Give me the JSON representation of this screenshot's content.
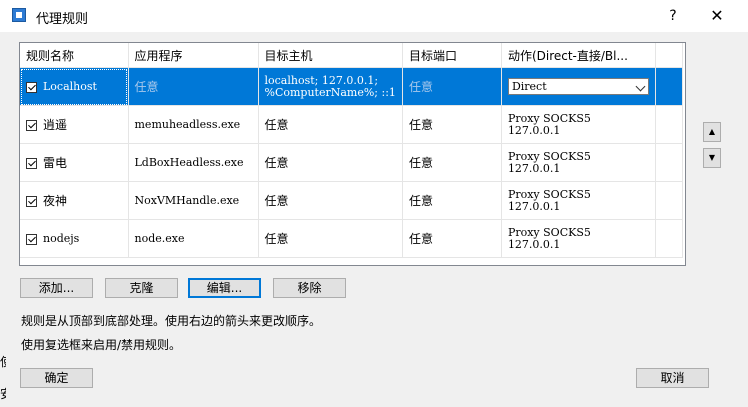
{
  "dialog": {
    "title": "代理规则",
    "help_label": "?",
    "close_label": "✕"
  },
  "table": {
    "columns": [
      "规则名称",
      "应用程序",
      "目标主机",
      "目标端口",
      "动作(Direct-直接/Bl..."
    ],
    "rows": [
      {
        "name": "Localhost",
        "app": "任意",
        "host_line1": "localhost; 127.0.0.1;",
        "host_line2": "%ComputerName%; ::1",
        "port": "任意",
        "action": "Direct",
        "checked": true,
        "selected": true
      },
      {
        "name": "逍遥",
        "app": "memuheadless.exe",
        "host": "任意",
        "port": "任意",
        "action_line1": "Proxy SOCKS5",
        "action_line2": "127.0.0.1",
        "checked": true
      },
      {
        "name": "雷电",
        "app": "LdBoxHeadless.exe",
        "host": "任意",
        "port": "任意",
        "action_line1": "Proxy SOCKS5",
        "action_line2": "127.0.0.1",
        "checked": true
      },
      {
        "name": "夜神",
        "app": "NoxVMHandle.exe",
        "host": "任意",
        "port": "任意",
        "action_line1": "Proxy SOCKS5",
        "action_line2": "127.0.0.1",
        "checked": true
      },
      {
        "name": "nodejs",
        "app": "node.exe",
        "host": "任意",
        "port": "任意",
        "action_line1": "Proxy SOCKS5",
        "action_line2": "127.0.0.1",
        "checked": true
      }
    ]
  },
  "side_buttons": {
    "up": "▲",
    "down": "▼"
  },
  "buttons": {
    "add": "添加...",
    "clone": "克隆",
    "edit": "编辑...",
    "remove": "移除",
    "ok": "确定",
    "cancel": "取消"
  },
  "info": {
    "line1": "规则是从顶部到底部处理。使用右边的箭头来更改顺序。",
    "line2": "使用复选框来启用/禁用规则。"
  },
  "background_fragments": {
    "a": "使",
    "b": "安"
  },
  "colors": {
    "selection": "#0078d7",
    "border": "#adadad"
  }
}
